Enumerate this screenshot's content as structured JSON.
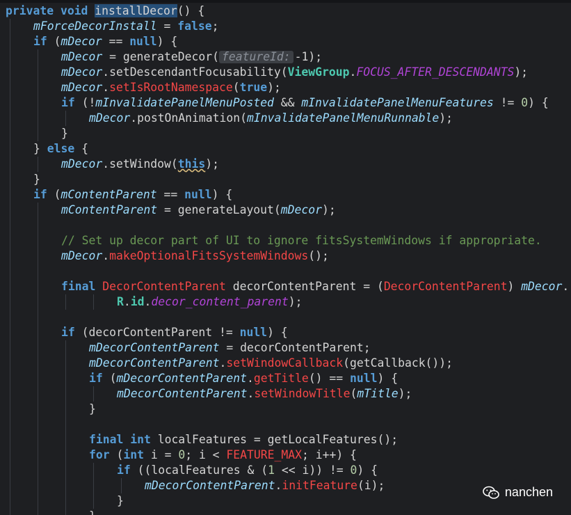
{
  "editor": {
    "lines": [
      {
        "indent": 0,
        "tokens": [
          {
            "t": "private ",
            "c": "k"
          },
          {
            "t": "void ",
            "c": "k"
          },
          {
            "t": "installDecor",
            "c": "m",
            "sel": true
          },
          {
            "t": "() {",
            "c": "m"
          }
        ]
      },
      {
        "indent": 1,
        "tokens": [
          {
            "t": "mForceDecorInstall",
            "c": "f"
          },
          {
            "t": " = ",
            "c": "m"
          },
          {
            "t": "false",
            "c": "k"
          },
          {
            "t": ";",
            "c": "m"
          }
        ]
      },
      {
        "indent": 1,
        "tokens": [
          {
            "t": "if ",
            "c": "k"
          },
          {
            "t": "(",
            "c": "m"
          },
          {
            "t": "mDecor",
            "c": "f"
          },
          {
            "t": " == ",
            "c": "m"
          },
          {
            "t": "null",
            "c": "k"
          },
          {
            "t": ") {",
            "c": "m"
          }
        ]
      },
      {
        "indent": 2,
        "tokens": [
          {
            "t": "mDecor",
            "c": "f"
          },
          {
            "t": " = generateDecor(",
            "c": "m"
          },
          {
            "t": "featureId:",
            "c": "hint"
          },
          {
            "t": "-1);",
            "c": "m"
          }
        ]
      },
      {
        "indent": 2,
        "tokens": [
          {
            "t": "mDecor",
            "c": "f"
          },
          {
            "t": ".setDescendantFocusability(",
            "c": "m"
          },
          {
            "t": "ViewGroup",
            "c": "g"
          },
          {
            "t": ".",
            "c": "m"
          },
          {
            "t": "FOCUS_AFTER_DESCENDANTS",
            "c": "s"
          },
          {
            "t": ");",
            "c": "m"
          }
        ]
      },
      {
        "indent": 2,
        "tokens": [
          {
            "t": "mDecor",
            "c": "f"
          },
          {
            "t": ".",
            "c": "m"
          },
          {
            "t": "setIsRootNamespace",
            "c": "r"
          },
          {
            "t": "(",
            "c": "m"
          },
          {
            "t": "true",
            "c": "k"
          },
          {
            "t": ");",
            "c": "m"
          }
        ]
      },
      {
        "indent": 2,
        "tokens": [
          {
            "t": "if ",
            "c": "k"
          },
          {
            "t": "(!",
            "c": "m"
          },
          {
            "t": "mInvalidatePanelMenuPosted",
            "c": "f"
          },
          {
            "t": " && ",
            "c": "m"
          },
          {
            "t": "mInvalidatePanelMenuFeatures",
            "c": "f"
          },
          {
            "t": " != ",
            "c": "m"
          },
          {
            "t": "0",
            "c": "n"
          },
          {
            "t": ") {",
            "c": "m"
          }
        ]
      },
      {
        "indent": 3,
        "tokens": [
          {
            "t": "mDecor",
            "c": "f"
          },
          {
            "t": ".postOnAnimation(",
            "c": "m"
          },
          {
            "t": "mInvalidatePanelMenuRunnable",
            "c": "f"
          },
          {
            "t": ");",
            "c": "m"
          }
        ]
      },
      {
        "indent": 2,
        "tokens": [
          {
            "t": "}",
            "c": "m"
          }
        ]
      },
      {
        "indent": 1,
        "tokens": [
          {
            "t": "} ",
            "c": "m"
          },
          {
            "t": "else",
            "c": "k"
          },
          {
            "t": " {",
            "c": "m"
          }
        ]
      },
      {
        "indent": 2,
        "tokens": [
          {
            "t": "mDecor",
            "c": "f"
          },
          {
            "t": ".setWindow(",
            "c": "m"
          },
          {
            "t": "this",
            "c": "k",
            "squig": true
          },
          {
            "t": ");",
            "c": "m"
          }
        ]
      },
      {
        "indent": 1,
        "tokens": [
          {
            "t": "}",
            "c": "m"
          }
        ]
      },
      {
        "indent": 1,
        "tokens": [
          {
            "t": "if ",
            "c": "k"
          },
          {
            "t": "(",
            "c": "m"
          },
          {
            "t": "mContentParent",
            "c": "f"
          },
          {
            "t": " == ",
            "c": "m"
          },
          {
            "t": "null",
            "c": "k"
          },
          {
            "t": ") {",
            "c": "m"
          }
        ]
      },
      {
        "indent": 2,
        "tokens": [
          {
            "t": "mContentParent",
            "c": "f"
          },
          {
            "t": " = generateLayout(",
            "c": "m"
          },
          {
            "t": "mDecor",
            "c": "f"
          },
          {
            "t": ");",
            "c": "m"
          }
        ]
      },
      {
        "indent": 0,
        "tokens": []
      },
      {
        "indent": 2,
        "tokens": [
          {
            "t": "// Set up decor part of UI to ignore fitsSystemWindows if appropriate.",
            "c": "c"
          }
        ]
      },
      {
        "indent": 2,
        "tokens": [
          {
            "t": "mDecor",
            "c": "f"
          },
          {
            "t": ".",
            "c": "m"
          },
          {
            "t": "makeOptionalFitsSystemWindows",
            "c": "r"
          },
          {
            "t": "();",
            "c": "m"
          }
        ]
      },
      {
        "indent": 0,
        "tokens": []
      },
      {
        "indent": 2,
        "tokens": [
          {
            "t": "final ",
            "c": "k"
          },
          {
            "t": "DecorContentParent",
            "c": "r"
          },
          {
            "t": " decorContentParent = (",
            "c": "m"
          },
          {
            "t": "DecorContentParent",
            "c": "r"
          },
          {
            "t": ") ",
            "c": "m"
          },
          {
            "t": "mDecor",
            "c": "f"
          },
          {
            "t": ".",
            "c": "m"
          }
        ]
      },
      {
        "indent": 4,
        "tokens": [
          {
            "t": "R",
            "c": "g"
          },
          {
            "t": ".",
            "c": "m"
          },
          {
            "t": "id",
            "c": "g"
          },
          {
            "t": ".",
            "c": "m"
          },
          {
            "t": "decor_content_parent",
            "c": "s"
          },
          {
            "t": ");",
            "c": "m"
          }
        ]
      },
      {
        "indent": 0,
        "tokens": []
      },
      {
        "indent": 2,
        "tokens": [
          {
            "t": "if ",
            "c": "k"
          },
          {
            "t": "(decorContentParent != ",
            "c": "m"
          },
          {
            "t": "null",
            "c": "k"
          },
          {
            "t": ") {",
            "c": "m"
          }
        ]
      },
      {
        "indent": 3,
        "tokens": [
          {
            "t": "mDecorContentParent",
            "c": "f"
          },
          {
            "t": " = decorContentParent;",
            "c": "m"
          }
        ]
      },
      {
        "indent": 3,
        "tokens": [
          {
            "t": "mDecorContentParent",
            "c": "f"
          },
          {
            "t": ".",
            "c": "m"
          },
          {
            "t": "setWindowCallback",
            "c": "r"
          },
          {
            "t": "(getCallback());",
            "c": "m"
          }
        ]
      },
      {
        "indent": 3,
        "tokens": [
          {
            "t": "if ",
            "c": "k"
          },
          {
            "t": "(",
            "c": "m"
          },
          {
            "t": "mDecorContentParent",
            "c": "f"
          },
          {
            "t": ".",
            "c": "m"
          },
          {
            "t": "getTitle",
            "c": "r"
          },
          {
            "t": "() == ",
            "c": "m"
          },
          {
            "t": "null",
            "c": "k"
          },
          {
            "t": ") {",
            "c": "m"
          }
        ]
      },
      {
        "indent": 4,
        "tokens": [
          {
            "t": "mDecorContentParent",
            "c": "f"
          },
          {
            "t": ".",
            "c": "m"
          },
          {
            "t": "setWindowTitle",
            "c": "r"
          },
          {
            "t": "(",
            "c": "m"
          },
          {
            "t": "mTitle",
            "c": "f"
          },
          {
            "t": ");",
            "c": "m"
          }
        ]
      },
      {
        "indent": 3,
        "tokens": [
          {
            "t": "}",
            "c": "m"
          }
        ]
      },
      {
        "indent": 0,
        "tokens": []
      },
      {
        "indent": 3,
        "tokens": [
          {
            "t": "final ",
            "c": "k"
          },
          {
            "t": "int ",
            "c": "k"
          },
          {
            "t": "localFeatures = getLocalFeatures();",
            "c": "m"
          }
        ]
      },
      {
        "indent": 3,
        "tokens": [
          {
            "t": "for ",
            "c": "k"
          },
          {
            "t": "(",
            "c": "m"
          },
          {
            "t": "int ",
            "c": "k"
          },
          {
            "t": "i = ",
            "c": "m"
          },
          {
            "t": "0",
            "c": "n"
          },
          {
            "t": "; i < ",
            "c": "m"
          },
          {
            "t": "FEATURE_MAX",
            "c": "r"
          },
          {
            "t": "; i++) {",
            "c": "m"
          }
        ]
      },
      {
        "indent": 4,
        "tokens": [
          {
            "t": "if ",
            "c": "k"
          },
          {
            "t": "((localFeatures & (",
            "c": "m"
          },
          {
            "t": "1",
            "c": "n"
          },
          {
            "t": " << i)) != ",
            "c": "m"
          },
          {
            "t": "0",
            "c": "n"
          },
          {
            "t": ") {",
            "c": "m"
          }
        ]
      },
      {
        "indent": 5,
        "tokens": [
          {
            "t": "mDecorContentParent",
            "c": "f"
          },
          {
            "t": ".",
            "c": "m"
          },
          {
            "t": "initFeature",
            "c": "r"
          },
          {
            "t": "(i);",
            "c": "m"
          }
        ]
      },
      {
        "indent": 4,
        "tokens": [
          {
            "t": "}",
            "c": "m"
          }
        ]
      },
      {
        "indent": 3,
        "tokens": [
          {
            "t": "}",
            "c": "m"
          }
        ]
      }
    ]
  },
  "watermark": {
    "icon": "wechat-icon",
    "text": "nanchen"
  }
}
